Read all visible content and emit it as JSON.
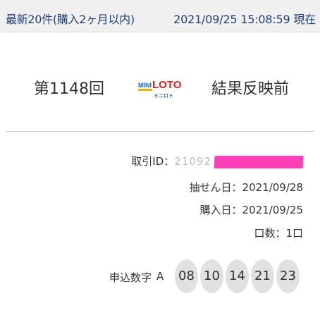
{
  "header": {
    "left_text": "最新20件(購入2ヶ月以内)",
    "right_text": "2021/09/25 15:08:59 現在"
  },
  "round": {
    "label": "第1148回",
    "status": "結果反映前",
    "logo": {
      "mini": "MINI",
      "loto": "LOTO",
      "kana": "ミニロト"
    }
  },
  "info": {
    "id_label": "取引ID：",
    "id_visible_fragment": "21092",
    "draw_date_label": "抽せん日：",
    "draw_date": "2021/09/28",
    "purchase_date_label": "購入日：",
    "purchase_date": "2021/09/25",
    "quantity_label": "口数：",
    "quantity": "1口"
  },
  "entry": {
    "label": "申込数字",
    "set": "A",
    "numbers": [
      "08",
      "10",
      "14",
      "21",
      "23"
    ]
  },
  "colors": {
    "header_bg": "#f0f0f0",
    "header_text": "#1f3f7a",
    "ball_bg": "#e1e1e1",
    "redaction": "#ff3fb7"
  }
}
